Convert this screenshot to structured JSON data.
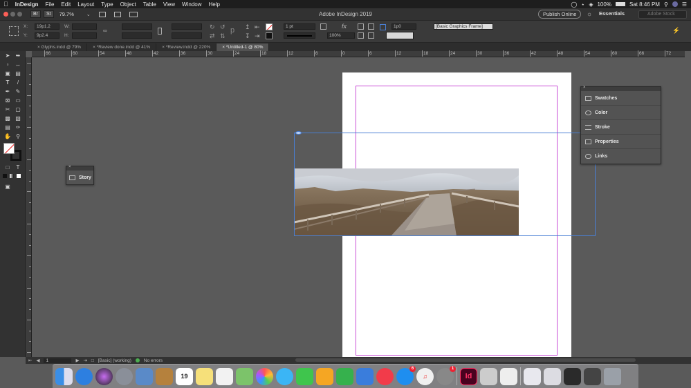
{
  "menubar": {
    "apple": "",
    "items": [
      "InDesign",
      "File",
      "Edit",
      "Layout",
      "Type",
      "Object",
      "Table",
      "View",
      "Window",
      "Help"
    ],
    "battery": "100%",
    "clock": "Sat 8:46 PM"
  },
  "appbar": {
    "br_label": "Br",
    "st_label": "St",
    "zoom": "79.7%",
    "title": "Adobe InDesign 2019",
    "publish": "Publish Online",
    "workspace": "Essentials",
    "stock_placeholder": "Adobe Stock"
  },
  "control": {
    "x_label": "X:",
    "y_label": "Y:",
    "x_value": "19p1.2",
    "y_value": "9p2.4",
    "w_label": "W:",
    "h_label": "H:",
    "stroke_weight": "1 pt",
    "opacity": "100%",
    "offset": "1p0",
    "object_style": "[Basic Graphics Frame]"
  },
  "tabs": [
    {
      "label": "Glyphs.indd @ 79%",
      "active": false
    },
    {
      "label": "*Review done.indd @ 41%",
      "active": false
    },
    {
      "label": "*Review.indd @ 220%",
      "active": false
    },
    {
      "label": "*Untitled-1 @ 80%",
      "active": true
    }
  ],
  "ruler": {
    "h_ticks": [
      "66",
      "60",
      "54",
      "48",
      "42",
      "36",
      "30",
      "24",
      "18",
      "12",
      "6",
      "0",
      "6",
      "12",
      "18",
      "24",
      "30",
      "36",
      "42",
      "48",
      "54",
      "60",
      "66",
      "72"
    ]
  },
  "panels": {
    "story": "Story",
    "right": [
      "Swatches",
      "Color",
      "Stroke",
      "Properties",
      "Links"
    ]
  },
  "status": {
    "page": "1",
    "preflight_profile": "[Basic] (working)",
    "errors": "No errors"
  },
  "dock": {
    "calendar_day": "19",
    "app_store_badge": "6",
    "prefs_badge": "1",
    "indesign_label": "Id",
    "apps": [
      "Finder",
      "Safari",
      "Siri",
      "Launchpad",
      "Preview",
      "Notefile",
      "Calendar",
      "Notes",
      "Reminders",
      "Maps",
      "Photos",
      "Messages",
      "FaceTime",
      "Pages",
      "Numbers",
      "Keynote",
      "News",
      "App Store",
      "Music",
      "System Preferences",
      "InDesign",
      "Script Editor",
      "TextEdit",
      "Files",
      "Folder",
      "Trash"
    ]
  },
  "colors": {
    "accent_margin": "#c84bd6",
    "frame_blue": "#4a7fd4"
  }
}
